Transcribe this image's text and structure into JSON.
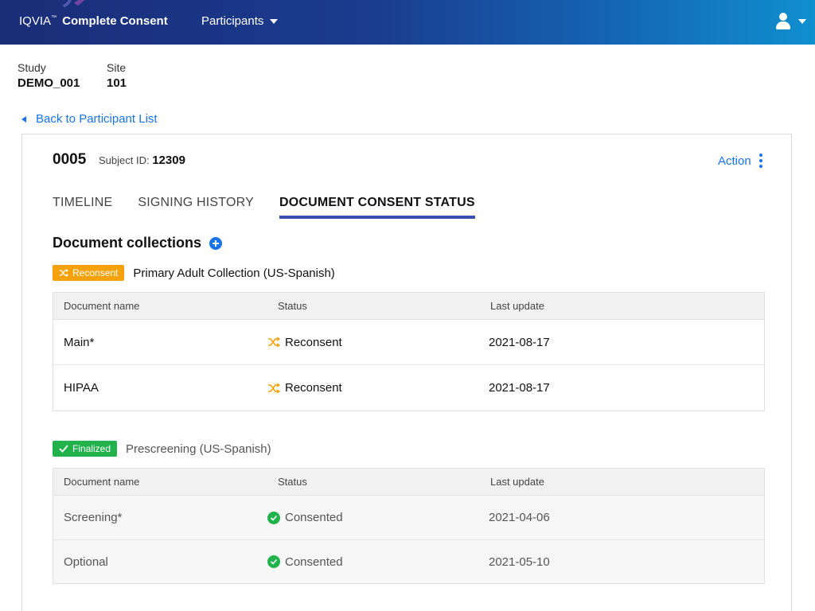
{
  "header": {
    "brand_iqvia": "IQVIA",
    "brand_tm": "™",
    "brand_product": "Complete Consent",
    "nav_participants": "Participants"
  },
  "study": {
    "label": "Study",
    "value": "DEMO_001"
  },
  "site": {
    "label": "Site",
    "value": "101"
  },
  "back_link": "Back to Participant List",
  "participant": {
    "number": "0005",
    "subject_label": "Subject ID:",
    "subject_id": "12309",
    "action_label": "Action"
  },
  "tabs": [
    {
      "label": "TIMELINE",
      "active": false
    },
    {
      "label": "SIGNING HISTORY",
      "active": false
    },
    {
      "label": "DOCUMENT CONSENT STATUS",
      "active": true
    }
  ],
  "document_collections": {
    "title": "Document collections",
    "columns": {
      "name": "Document name",
      "status": "Status",
      "updated": "Last update"
    },
    "collections": [
      {
        "badge": "Reconsent",
        "badge_color": "#f5a20a",
        "name": "Primary Adult Collection (US-Spanish)",
        "rows": [
          {
            "name": "Main*",
            "status": "Reconsent",
            "updated": "2021-08-17"
          },
          {
            "name": "HIPAA",
            "status": "Reconsent",
            "updated": "2021-08-17"
          }
        ]
      },
      {
        "badge": "Finalized",
        "badge_color": "#22b24c",
        "name": "Prescreening (US-Spanish)",
        "rows": [
          {
            "name": "Screening*",
            "status": "Consented",
            "updated": "2021-04-06"
          },
          {
            "name": "Optional",
            "status": "Consented",
            "updated": "2021-05-10"
          }
        ]
      }
    ]
  },
  "icons": {
    "reconsent": "shuffle-icon",
    "consented": "check-circle-icon",
    "add": "plus-circle-icon",
    "user": "user-icon"
  }
}
